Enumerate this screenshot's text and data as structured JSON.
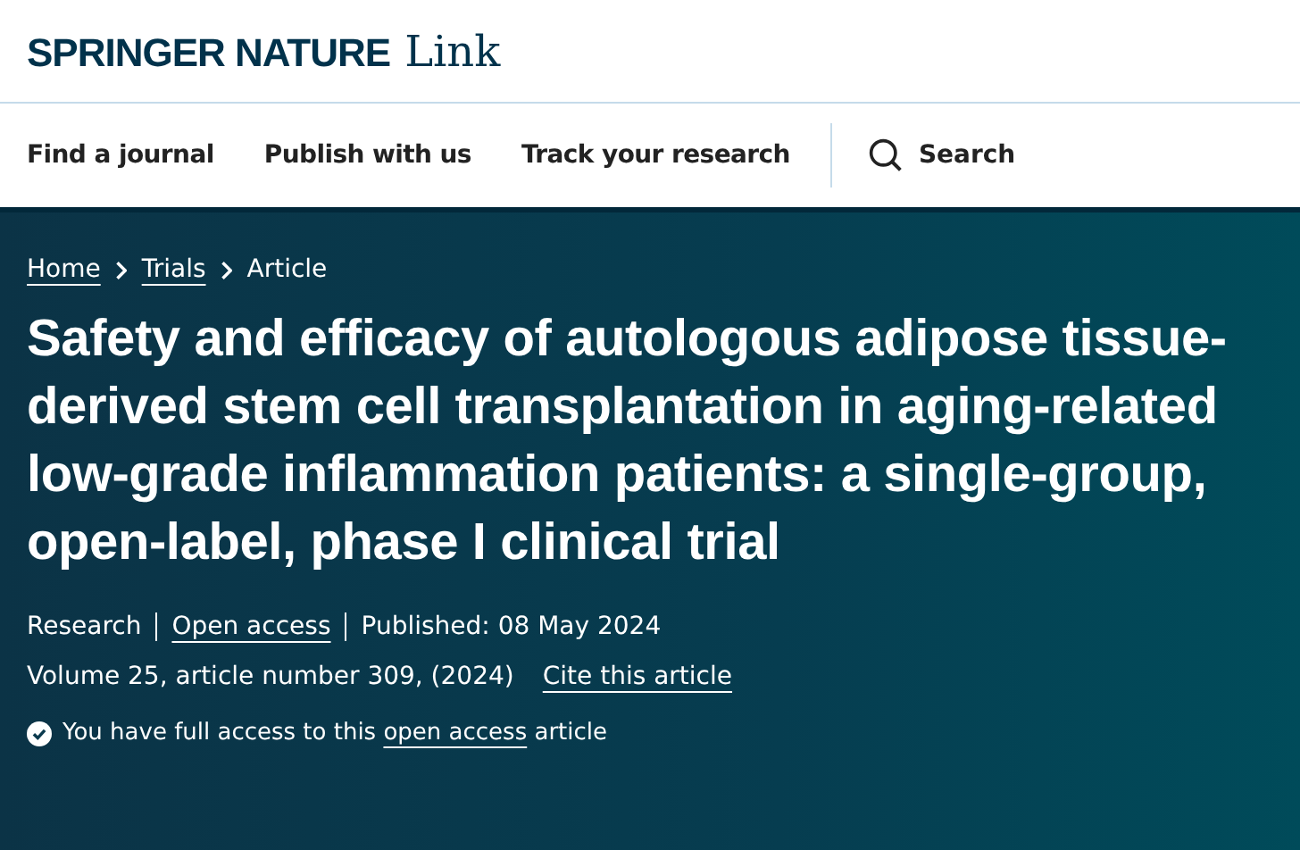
{
  "logo": {
    "brand": "SPRINGER NATURE",
    "product": "Link"
  },
  "nav": [
    {
      "label": "Find a journal"
    },
    {
      "label": "Publish with us"
    },
    {
      "label": "Track your research"
    }
  ],
  "search": {
    "label": "Search"
  },
  "breadcrumbs": [
    {
      "label": "Home",
      "kind": "link"
    },
    {
      "label": "Trials",
      "kind": "link"
    },
    {
      "label": "Article",
      "kind": "current"
    }
  ],
  "title": "Safety and efficacy of autologous adipose tissue-derived stem cell transplantation in aging-related low-grade inflammation patients: a single-group, open-label, phase I clinical trial",
  "meta": [
    {
      "label": "Research",
      "kind": "text"
    },
    {
      "label": "Open access",
      "kind": "link"
    },
    {
      "label": "Published: 08 May 2024",
      "kind": "text"
    }
  ],
  "citation": {
    "text": "Volume 25, article number 309, (2024)",
    "link": "Cite this article"
  },
  "access": {
    "before": "You have full access to this",
    "link": "open access",
    "after": "article"
  }
}
